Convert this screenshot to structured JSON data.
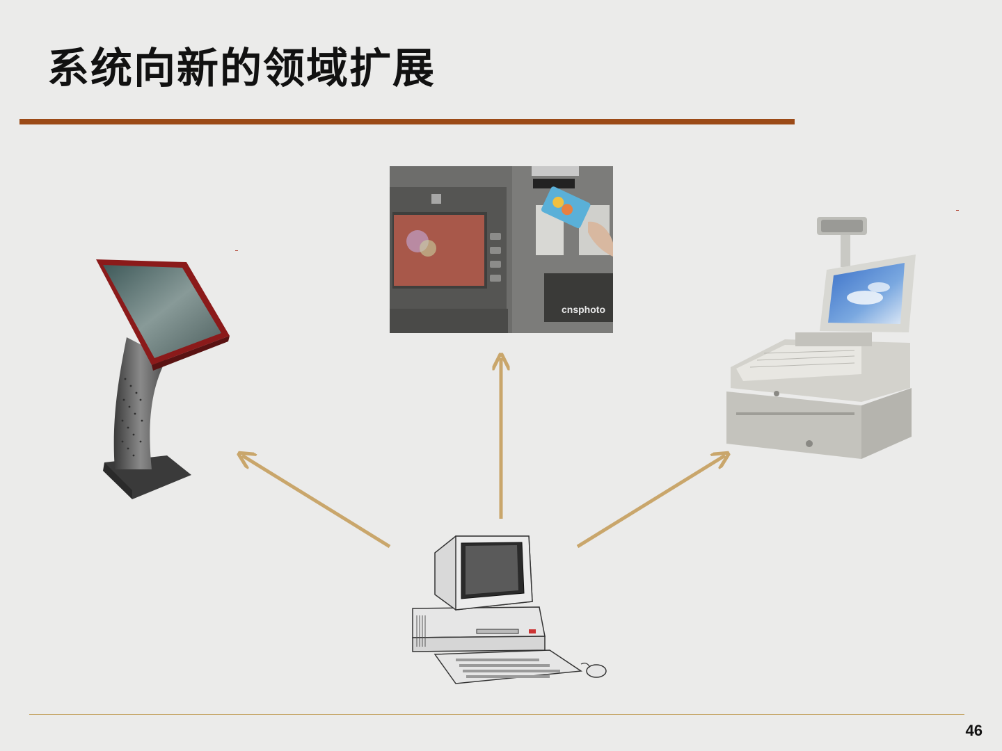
{
  "slide": {
    "title": "系统向新的领域扩展",
    "page_number": "46"
  },
  "images": {
    "atm_watermark": "cnsphoto"
  },
  "colors": {
    "background": "#ebebea",
    "title_rule": "#9b4a17",
    "arrow": "#c9a66b",
    "bottom_rule": "#c8aa70"
  },
  "icons": [
    "kiosk-icon",
    "atm-icon",
    "cash-register-icon",
    "desktop-computer-icon"
  ]
}
